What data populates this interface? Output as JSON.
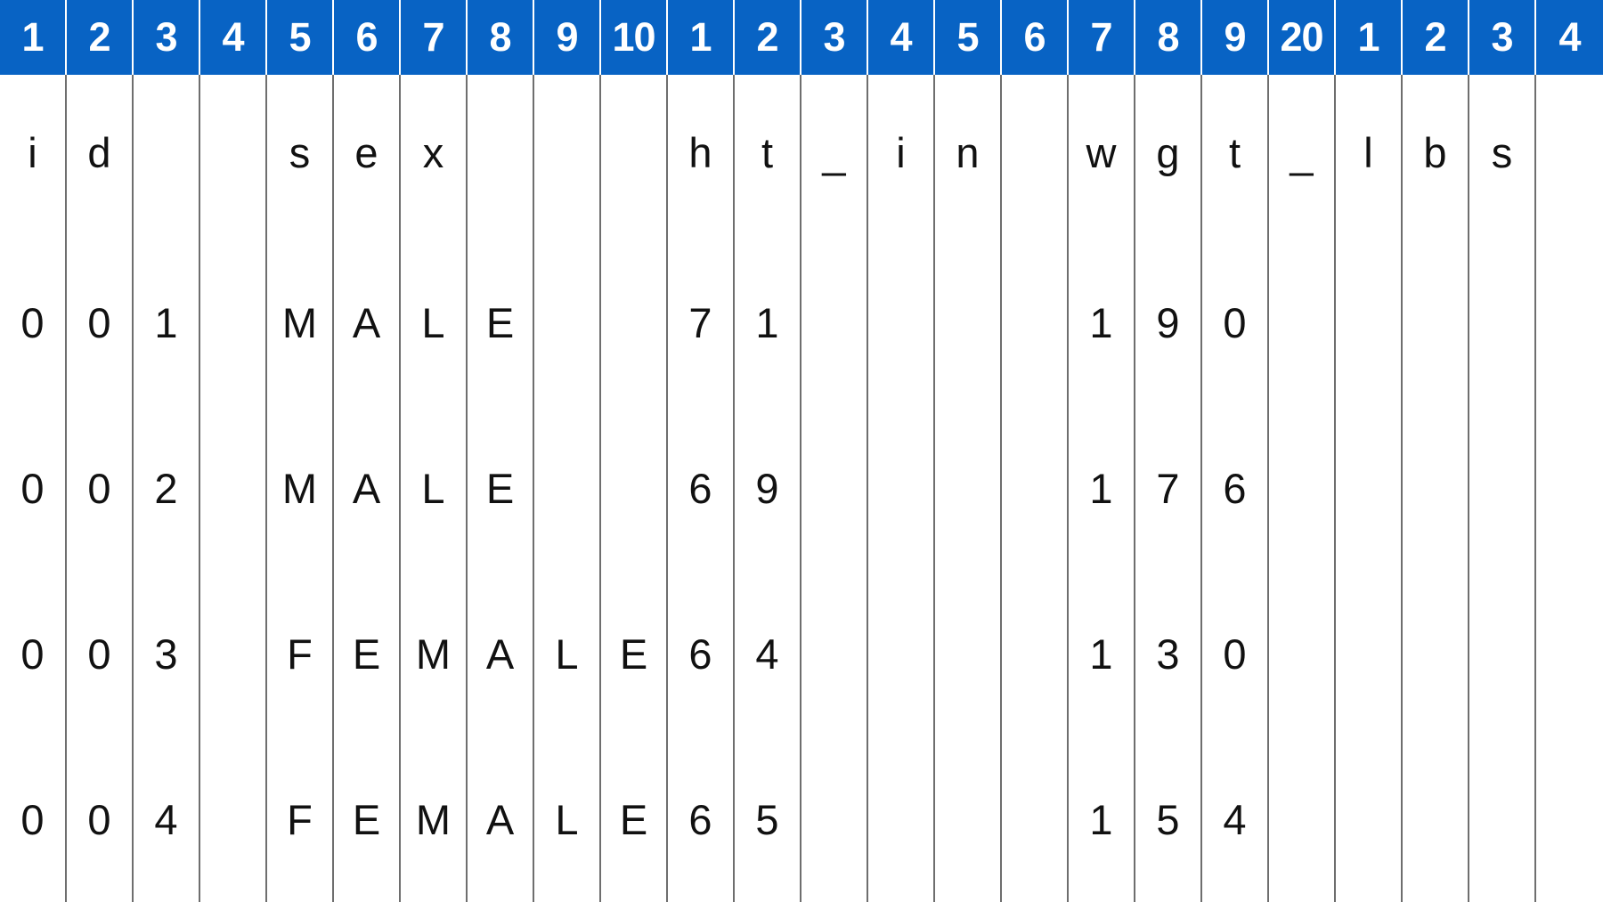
{
  "ruler": [
    "1",
    "2",
    "3",
    "4",
    "5",
    "6",
    "7",
    "8",
    "9",
    "10",
    "1",
    "2",
    "3",
    "4",
    "5",
    "6",
    "7",
    "8",
    "9",
    "20",
    "1",
    "2",
    "3",
    "4"
  ],
  "rows": [
    [
      "i",
      "d",
      "",
      "",
      "s",
      "e",
      "x",
      "",
      "",
      "",
      "h",
      "t",
      "_",
      "i",
      "n",
      "",
      "w",
      "g",
      "t",
      "_",
      "l",
      "b",
      "s"
    ],
    [
      "0",
      "0",
      "1",
      "",
      "M",
      "A",
      "L",
      "E",
      "",
      "",
      "7",
      "1",
      "",
      "",
      "",
      "",
      "1",
      "9",
      "0",
      "",
      "",
      "",
      ""
    ],
    [
      "0",
      "0",
      "2",
      "",
      "M",
      "A",
      "L",
      "E",
      "",
      "",
      "6",
      "9",
      "",
      "",
      "",
      "",
      "1",
      "7",
      "6",
      "",
      "",
      "",
      ""
    ],
    [
      "0",
      "0",
      "3",
      "",
      "F",
      "E",
      "M",
      "A",
      "L",
      "E",
      "6",
      "4",
      "",
      "",
      "",
      "",
      "1",
      "3",
      "0",
      "",
      "",
      "",
      ""
    ],
    [
      "0",
      "0",
      "4",
      "",
      "F",
      "E",
      "M",
      "A",
      "L",
      "E",
      "6",
      "5",
      "",
      "",
      "",
      "",
      "1",
      "5",
      "4",
      "",
      "",
      "",
      ""
    ]
  ],
  "colors": {
    "header_bg": "#0863c4",
    "header_text": "#ffffff",
    "divider": "#6e6e6e"
  }
}
